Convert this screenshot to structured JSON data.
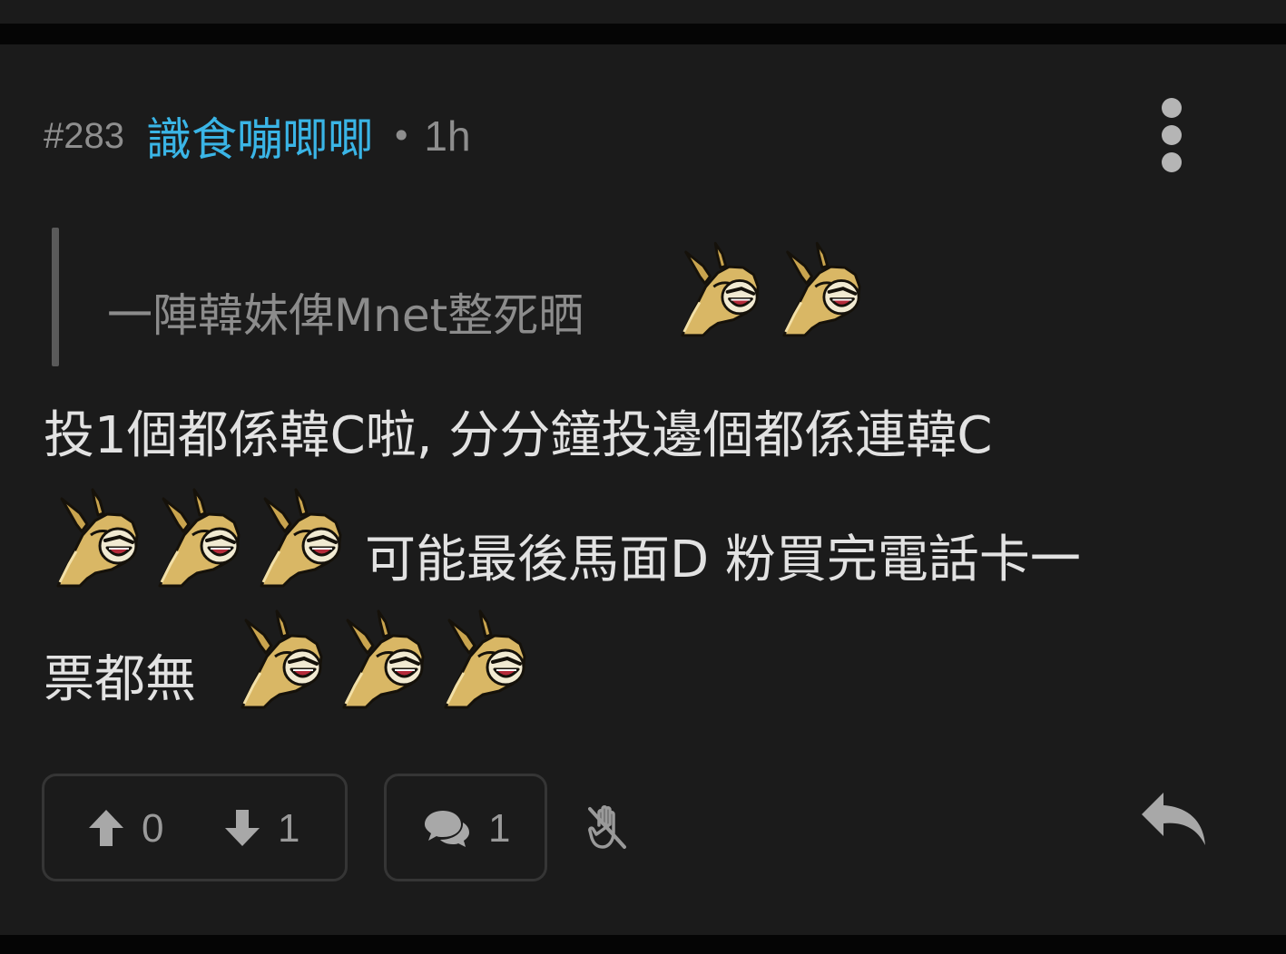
{
  "post": {
    "number": "#283",
    "author": "識食嘣唧唧",
    "separator": "•",
    "time": "1h",
    "quote": "一陣韓妹俾Mnet整死晒",
    "body_line1": "投1個都係韓C啦, 分分鐘投邊個都係連韓C",
    "body_line2": "可能最後馬面D 粉買完電話卡一",
    "body_line3": "票都無",
    "emoji_name": "lihkg-horse-laugh-icon"
  },
  "actions": {
    "upvotes": "0",
    "downvotes": "1",
    "comments": "1"
  },
  "colors": {
    "background": "#1b1b1b",
    "author": "#3ab5e6",
    "meta_grey": "#8e8e8e",
    "body_text": "#e2e2e2",
    "emoji_gold": "#d9b765"
  }
}
